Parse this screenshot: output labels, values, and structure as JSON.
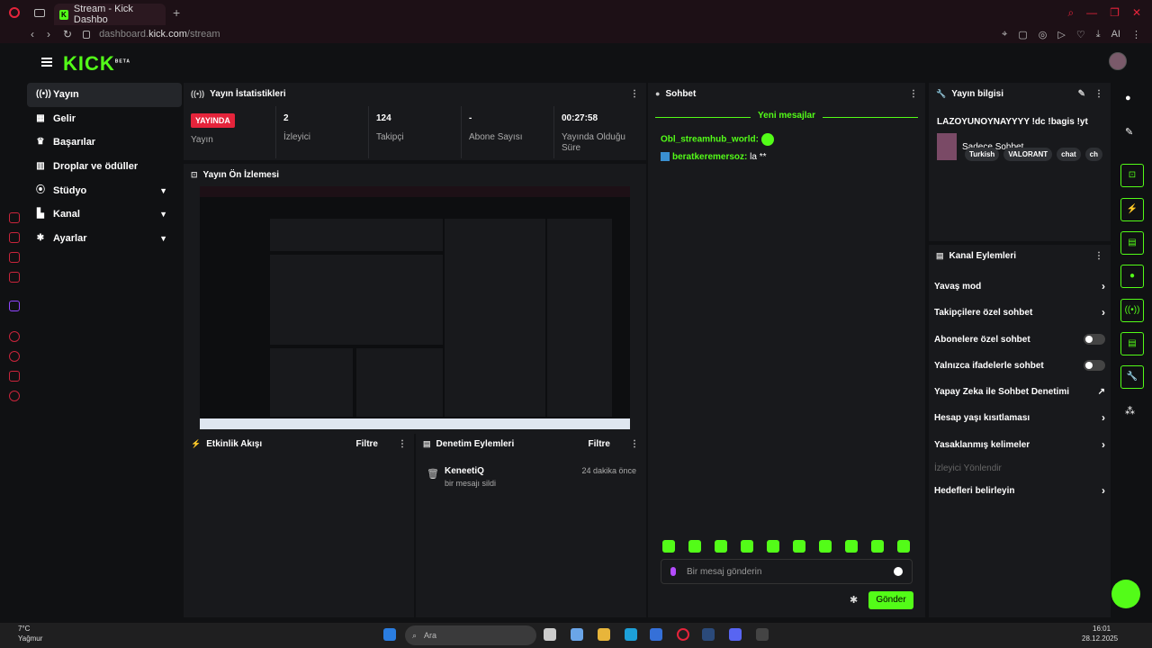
{
  "browser": {
    "tab_title": "Stream - Kick Dashbo",
    "url_prefix": "dashboard.",
    "url_domain": "kick.com",
    "url_path": "/stream",
    "ai_label": "AI"
  },
  "logo": "KICK",
  "logo_badge": "BETA",
  "nav": [
    {
      "label": "Yayın",
      "icon": "broadcast-icon"
    },
    {
      "label": "Gelir",
      "icon": "money-icon"
    },
    {
      "label": "Başarılar",
      "icon": "trophy-icon"
    },
    {
      "label": "Droplar ve ödüller",
      "icon": "drops-icon"
    },
    {
      "label": "Stüdyo",
      "icon": "studio-icon"
    },
    {
      "label": "Kanal",
      "icon": "channel-icon"
    },
    {
      "label": "Ayarlar",
      "icon": "gear-icon"
    }
  ],
  "stats": {
    "title": "Yayın İstatistikleri",
    "live_badge": "YAYINDA",
    "items": [
      {
        "value": "",
        "label": "Yayın"
      },
      {
        "value": "2",
        "label": "İzleyici"
      },
      {
        "value": "124",
        "label": "Takipçi"
      },
      {
        "value": "-",
        "label": "Abone Sayısı"
      },
      {
        "value": "00:27:58",
        "label": "Yayında Olduğu Süre"
      }
    ]
  },
  "preview": {
    "title": "Yayın Ön İzlemesi"
  },
  "activity": {
    "title": "Etkinlik Akışı",
    "filter": "Filtre"
  },
  "moderation": {
    "title": "Denetim Eylemleri",
    "filter": "Filtre",
    "entry_user": "KeneetiQ",
    "entry_action": "bir mesajı sildi",
    "entry_time": "24 dakika önce"
  },
  "chat": {
    "title": "Sohbet",
    "new_messages": "Yeni mesajlar",
    "messages": [
      {
        "user": "Obl_streamhub_world:",
        "text": ""
      },
      {
        "user": "beratkeremersoz:",
        "text": "la **"
      }
    ],
    "placeholder": "Bir mesaj gönderin",
    "send": "Gönder"
  },
  "info": {
    "title": "Yayın bilgisi",
    "stream_title": "LAZOYUNOYNAYYYY !dc !bagis !yt",
    "category": "Sadece Sohbet",
    "tags": [
      "Turkish",
      "VALORANT",
      "chat",
      "ch"
    ]
  },
  "actions": {
    "title": "Kanal Eylemleri",
    "items": [
      {
        "label": "Yavaş mod",
        "type": "arrow"
      },
      {
        "label": "Takipçilere özel sohbet",
        "type": "arrow"
      },
      {
        "label": "Abonelere özel sohbet",
        "type": "toggle"
      },
      {
        "label": "Yalnızca ifadelerle sohbet",
        "type": "toggle"
      },
      {
        "label": "Yapay Zeka ile Sohbet Denetimi",
        "type": "external"
      },
      {
        "label": "Hesap yaşı kısıtlaması",
        "type": "arrow"
      },
      {
        "label": "Yasaklanmış kelimeler",
        "type": "arrow"
      },
      {
        "label": "İzleyici Yönlendir",
        "type": "disabled"
      },
      {
        "label": "Hedefleri belirleyin",
        "type": "arrow"
      }
    ]
  },
  "taskbar": {
    "temp": "7°C",
    "weather": "Yağmur",
    "search": "Ara",
    "time": "16:01",
    "date": "28.12.2025"
  }
}
